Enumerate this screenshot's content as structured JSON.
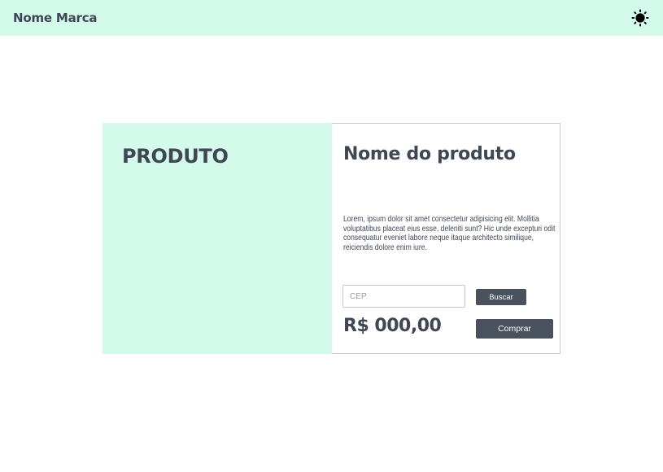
{
  "navbar": {
    "brand": "Nome Marca",
    "theme_icon": "sun-icon",
    "background": "#d4faeb"
  },
  "product": {
    "image_label": "PRODUTO",
    "name": "Nome do produto",
    "description": "Lorem, ipsum dolor sit amet consectetur adipisicing elit. Mollitia voluptatibus placeat eius esse, deleniti sunt? Hic unde excepturi odit consequatur eveniet labore neque itaque architecto similique, reiciendis dolore enim iure.",
    "price": "R$ 000,00"
  },
  "shipping": {
    "cep_placeholder": "CEP",
    "cep_value": "",
    "search_label": "Buscar"
  },
  "actions": {
    "buy_label": "Comprar"
  },
  "colors": {
    "accent": "#d4faeb",
    "button": "#4a525e",
    "text": "#3f4754"
  }
}
